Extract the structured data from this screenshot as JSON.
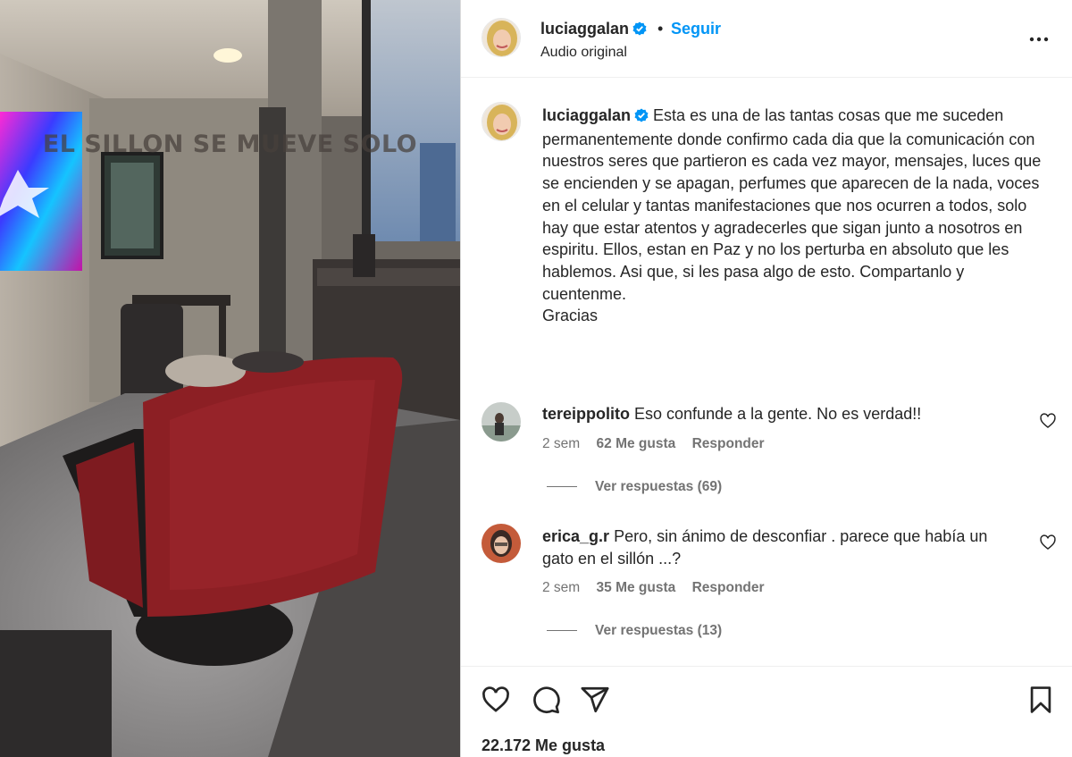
{
  "video": {
    "overlay_text": "EL SILLON SE MUEVE SOLO"
  },
  "post": {
    "author": {
      "username": "luciaggalan",
      "verified": true,
      "follow_label": "Seguir",
      "audio_label": "Audio original"
    },
    "caption": {
      "username": "luciaggalan",
      "text": "Esta es una de las tantas cosas que me suceden permanentemente donde confirmo cada dia que la comunicación con nuestros seres que partieron es cada vez mayor, mensajes, luces que se encienden y se apagan, perfumes que aparecen de la nada, voces en el celular y tantas manifestaciones que nos ocurren a todos, solo hay que estar atentos y agradecerles que sigan junto a nosotros en espiritu. Ellos, estan en Paz y no los perturba en absoluto que les hablemos. Asi que, si les pasa algo de esto. Compartanlo y cuentenme.",
      "closing": "Gracias"
    },
    "comments": [
      {
        "username": "tereippolito",
        "text": "Eso confunde a la gente. No es verdad!!",
        "time": "2 sem",
        "likes": "62 Me gusta",
        "reply_label": "Responder",
        "view_replies": "Ver respuestas (69)"
      },
      {
        "username": "erica_g.r",
        "text": "Pero, sin ánimo de desconfiar . parece que había un gato en el sillón ...?",
        "time": "2 sem",
        "likes": "35 Me gusta",
        "reply_label": "Responder",
        "view_replies": "Ver respuestas (13)"
      }
    ],
    "likes_count": "22.172 Me gusta"
  },
  "icons": {
    "more": "more-options-icon",
    "verified": "verified-badge-icon",
    "like": "heart-icon",
    "comment": "comment-icon",
    "share": "share-icon",
    "save": "bookmark-icon"
  },
  "colors": {
    "accent": "#0095f6",
    "text": "#262626",
    "secondary": "#737373",
    "chair": "#8c1f24"
  }
}
